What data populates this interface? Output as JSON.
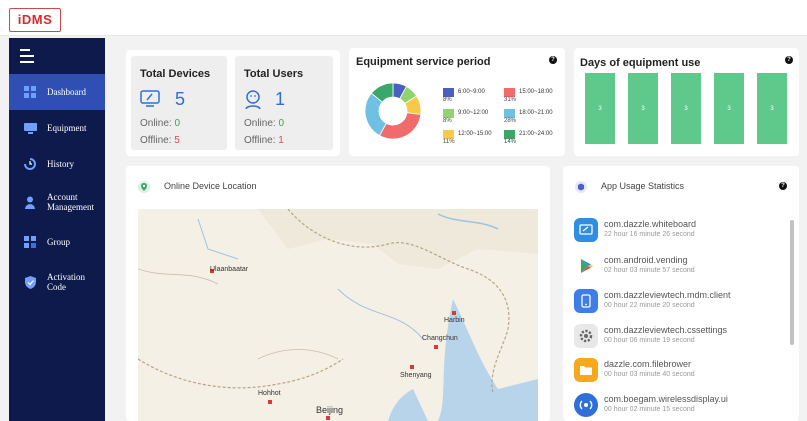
{
  "brand": {
    "logo_text": "iDMS"
  },
  "sidebar": {
    "items": [
      {
        "label": "Dashboard",
        "icon": "dashboard-icon",
        "active": true
      },
      {
        "label": "Equipment",
        "icon": "monitor-icon",
        "active": false
      },
      {
        "label": "History",
        "icon": "history-icon",
        "active": false
      },
      {
        "label": "Account Management",
        "icon": "user-icon",
        "active": false
      },
      {
        "label": "Group",
        "icon": "group-icon",
        "active": false
      },
      {
        "label": "Activation Code",
        "icon": "shield-icon",
        "active": false
      }
    ]
  },
  "stats": {
    "devices": {
      "title": "Total Devices",
      "count": "5",
      "online_label": "Online:",
      "online_value": "0",
      "offline_label": "Offline:",
      "offline_value": "5"
    },
    "users": {
      "title": "Total Users",
      "count": "1",
      "online_label": "Online:",
      "online_value": "0",
      "offline_label": "Offline:",
      "offline_value": "1"
    }
  },
  "service_period": {
    "title": "Equipment service period",
    "legend": [
      {
        "range": "6:00~9:00",
        "pct": "8%",
        "color": "#4a5fc1"
      },
      {
        "range": "15:00~18:00",
        "pct": "31%",
        "color": "#f06b6b"
      },
      {
        "range": "9:00~12:00",
        "pct": "8%",
        "color": "#8fd46e"
      },
      {
        "range": "18:00~21:00",
        "pct": "28%",
        "color": "#6fc0e2"
      },
      {
        "range": "12:00~15:00",
        "pct": "11%",
        "color": "#f7c948"
      },
      {
        "range": "21:00~24:00",
        "pct": "14%",
        "color": "#3aa86b"
      }
    ]
  },
  "days_of_use": {
    "title": "Days of equipment use",
    "bars": [
      "3",
      "3",
      "3",
      "3",
      "3"
    ],
    "bar_color": "#5ec98a"
  },
  "location": {
    "title": "Online Device Location",
    "cities": [
      "Ulaanbaatar",
      "Harbin",
      "Changchun",
      "Shenyang",
      "Hohhot",
      "Beijing"
    ]
  },
  "app_usage": {
    "title": "App Usage Statistics",
    "apps": [
      {
        "name": "com.dazzle.whiteboard",
        "time": "22 hour 16 minute 26 second",
        "icon": "whiteboard-icon"
      },
      {
        "name": "com.android.vending",
        "time": "02 hour 03 minute 57 second",
        "icon": "play-store-icon"
      },
      {
        "name": "com.dazzleviewtech.mdm.client",
        "time": "00 hour 22 minute 20 second",
        "icon": "mdm-client-icon"
      },
      {
        "name": "com.dazzleviewtech.cssettings",
        "time": "00 hour 06 minute 19 second",
        "icon": "settings-gear-icon"
      },
      {
        "name": "dazzle.com.filebrower",
        "time": "00 hour 03 minute 40 second",
        "icon": "folder-icon"
      },
      {
        "name": "com.boegam.wirelessdisplay.ui",
        "time": "00 hour 02 minute 15 second",
        "icon": "wireless-display-icon"
      }
    ]
  }
}
